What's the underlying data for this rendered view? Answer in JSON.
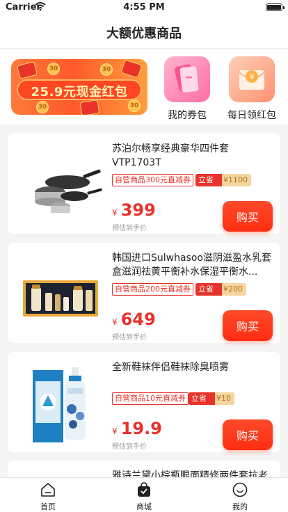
{
  "status": {
    "carrier": "Carrier",
    "time": "4:55 PM"
  },
  "nav": {
    "title": "大额优惠商品"
  },
  "banner": {
    "text": "25.9元现金红包",
    "coin_text": "30"
  },
  "shortcuts": [
    {
      "label": "我的券包",
      "icon": "coupon-wallet-icon"
    },
    {
      "label": "每日领红包",
      "icon": "red-packet-icon"
    }
  ],
  "products": [
    {
      "name": "苏泊尔畅享经典豪华四件套VTP1703T",
      "image": "cookware-set",
      "coupon": "自营商品300元直减券",
      "save_tag": "立省",
      "save_amount": "¥1100",
      "currency": "¥",
      "price": "399",
      "est_label": "预估到手价",
      "buy_label": "购买"
    },
    {
      "name": "韩国进口Sulwhasoo滋阴滋盈水乳套盒滋润祛黄平衡补水保湿平衡水...",
      "image": "skincare-gift-box",
      "coupon": "自营商品200元直减券",
      "save_tag": "立省",
      "save_amount": "¥200",
      "currency": "¥",
      "price": "649",
      "est_label": "预估到手价",
      "buy_label": "购买"
    },
    {
      "name": "全新鞋袜伴侣鞋袜除臭喷雾",
      "image": "deodorant-spray",
      "coupon": "自营商品10元直减券",
      "save_tag": "立省",
      "save_amount": "¥10",
      "currency": "¥",
      "price": "19.9",
      "est_label": "预估到手价",
      "buy_label": "购买"
    },
    {
      "name": "雅诗兰黛小棕瓶眼面精修两件套抗老"
    }
  ],
  "tabs": [
    {
      "label": "首页",
      "icon": "home-icon"
    },
    {
      "label": "商城",
      "icon": "shopping-bag-icon"
    },
    {
      "label": "我的",
      "icon": "smiley-icon"
    }
  ],
  "colors": {
    "accent": "#e8322a",
    "save_badge": "#f5d6a0",
    "background": "#f4f4f4"
  }
}
